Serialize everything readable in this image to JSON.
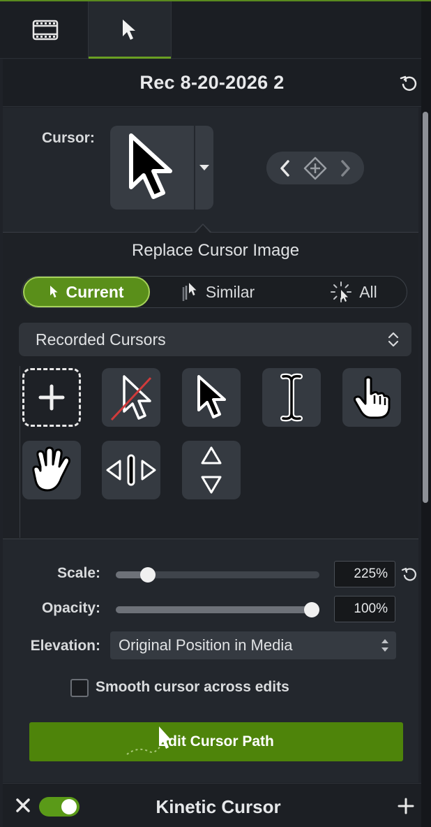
{
  "tabs": [
    {
      "name": "media",
      "icon": "film-strip-icon"
    },
    {
      "name": "cursor",
      "icon": "cursor-arrow-icon",
      "active": true
    }
  ],
  "title": "Rec 8-20-2026 2",
  "cursor": {
    "label": "Cursor:",
    "preview_icon": "arrow-cursor-icon"
  },
  "replace": {
    "title": "Replace Cursor Image",
    "segments": [
      {
        "label": "Current",
        "selected": true
      },
      {
        "label": "Similar",
        "selected": false
      },
      {
        "label": "All",
        "selected": false
      }
    ],
    "source": "Recorded Cursors",
    "cursors": [
      {
        "icon": "add-cursor-icon"
      },
      {
        "icon": "hidden-cursor-icon"
      },
      {
        "icon": "arrow-cursor-icon"
      },
      {
        "icon": "i-beam-cursor-icon"
      },
      {
        "icon": "pointing-hand-cursor-icon"
      },
      {
        "icon": "open-hand-cursor-icon"
      },
      {
        "icon": "resize-horizontal-cursor-icon"
      },
      {
        "icon": "resize-vertical-cursor-icon"
      }
    ]
  },
  "scale": {
    "label": "Scale:",
    "value": "225%",
    "fraction": 0.13
  },
  "opacity": {
    "label": "Opacity:",
    "value": "100%",
    "fraction": 1.0
  },
  "elevation": {
    "label": "Elevation:",
    "value": "Original Position in Media"
  },
  "smooth": {
    "label": "Smooth cursor across edits",
    "checked": false
  },
  "edit_path": {
    "label": "Edit Cursor Path"
  },
  "footer": {
    "title": "Kinetic Cursor",
    "enabled": true
  },
  "colors": {
    "accent": "#5a8f1a",
    "accent_border": "#a6d25a",
    "button": "#4e840a"
  }
}
